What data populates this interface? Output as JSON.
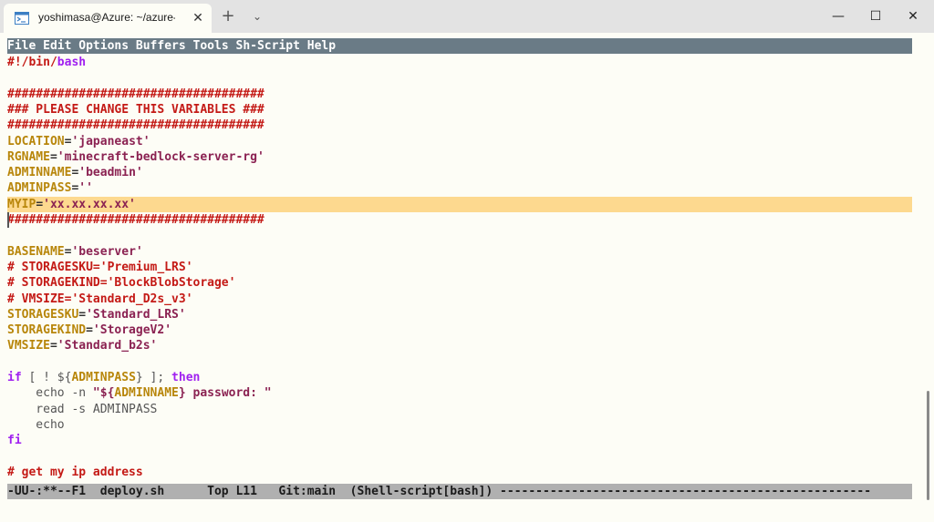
{
  "window": {
    "tab_title": "yoshimasa@Azure: ~/azure-mir",
    "tab_close": "✕",
    "new_tab": "+",
    "tab_dropdown": "⌄",
    "minimize": "—",
    "maximize": "☐",
    "close": "✕",
    "icons": [
      "terminal-icon"
    ]
  },
  "menubar": {
    "items": [
      "File",
      "Edit",
      "Options",
      "Buffers",
      "Tools",
      "Sh-Script",
      "Help"
    ]
  },
  "editor": {
    "lines": [
      [
        {
          "t": "#!/bin/",
          "c": "c-comment"
        },
        {
          "t": "bash",
          "c": "c-kw"
        }
      ],
      [],
      [
        {
          "t": "####################################",
          "c": "c-comment"
        }
      ],
      [
        {
          "t": "### PLEASE CHANGE THIS VARIABLES ###",
          "c": "c-comment"
        }
      ],
      [
        {
          "t": "####################################",
          "c": "c-comment"
        }
      ],
      [
        {
          "t": "LOCATION",
          "c": "c-var"
        },
        {
          "t": "=",
          "c": "c-plain"
        },
        {
          "t": "'japaneast'",
          "c": "c-str"
        }
      ],
      [
        {
          "t": "RGNAME",
          "c": "c-var"
        },
        {
          "t": "=",
          "c": "c-plain"
        },
        {
          "t": "'minecraft-bedlock-server-rg'",
          "c": "c-str"
        }
      ],
      [
        {
          "t": "ADMINNAME",
          "c": "c-var"
        },
        {
          "t": "=",
          "c": "c-plain"
        },
        {
          "t": "'beadmin'",
          "c": "c-str"
        }
      ],
      [
        {
          "t": "ADMINPASS",
          "c": "c-var"
        },
        {
          "t": "=",
          "c": "c-plain"
        },
        {
          "t": "''",
          "c": "c-str"
        }
      ],
      [
        {
          "t": "MYIP",
          "c": "c-var"
        },
        {
          "t": "=",
          "c": "c-plain"
        },
        {
          "t": "'xx.xx.xx.xx'",
          "c": "c-str"
        }
      ],
      [
        {
          "t": "####################################",
          "c": "c-comment"
        }
      ],
      [],
      [
        {
          "t": "BASENAME",
          "c": "c-var"
        },
        {
          "t": "=",
          "c": "c-plain"
        },
        {
          "t": "'beserver'",
          "c": "c-str"
        }
      ],
      [
        {
          "t": "# STORAGESKU='Premium_LRS'",
          "c": "c-comment"
        }
      ],
      [
        {
          "t": "# STORAGEKIND='BlockBlobStorage'",
          "c": "c-comment"
        }
      ],
      [
        {
          "t": "# VMSIZE='Standard_D2s_v3'",
          "c": "c-comment"
        }
      ],
      [
        {
          "t": "STORAGESKU",
          "c": "c-var"
        },
        {
          "t": "=",
          "c": "c-plain"
        },
        {
          "t": "'Standard_LRS'",
          "c": "c-str"
        }
      ],
      [
        {
          "t": "STORAGEKIND",
          "c": "c-var"
        },
        {
          "t": "=",
          "c": "c-plain"
        },
        {
          "t": "'StorageV2'",
          "c": "c-str"
        }
      ],
      [
        {
          "t": "VMSIZE",
          "c": "c-var"
        },
        {
          "t": "=",
          "c": "c-plain"
        },
        {
          "t": "'Standard_b2s'",
          "c": "c-str"
        }
      ],
      [],
      [
        {
          "t": "if",
          "c": "c-kw"
        },
        {
          "t": " [ ! ${",
          "c": "c-builtin"
        },
        {
          "t": "ADMINPASS",
          "c": "c-var"
        },
        {
          "t": "} ]; ",
          "c": "c-builtin"
        },
        {
          "t": "then",
          "c": "c-kw"
        }
      ],
      [
        {
          "t": "    echo -n ",
          "c": "c-builtin"
        },
        {
          "t": "\"${",
          "c": "c-str"
        },
        {
          "t": "ADMINNAME",
          "c": "c-var"
        },
        {
          "t": "} password: \"",
          "c": "c-str"
        }
      ],
      [
        {
          "t": "    read -s ADMINPASS",
          "c": "c-builtin"
        }
      ],
      [
        {
          "t": "    echo",
          "c": "c-builtin"
        }
      ],
      [
        {
          "t": "fi",
          "c": "c-kw"
        }
      ],
      [],
      [
        {
          "t": "# get my ip address",
          "c": "c-comment"
        }
      ]
    ],
    "highlighted_line": 9,
    "cursor_line": 10
  },
  "modeline": {
    "text": "-UU-:**--F1  deploy.sh      Top L11   Git:main  (Shell-script[bash]) ----------------------------------------------------"
  }
}
